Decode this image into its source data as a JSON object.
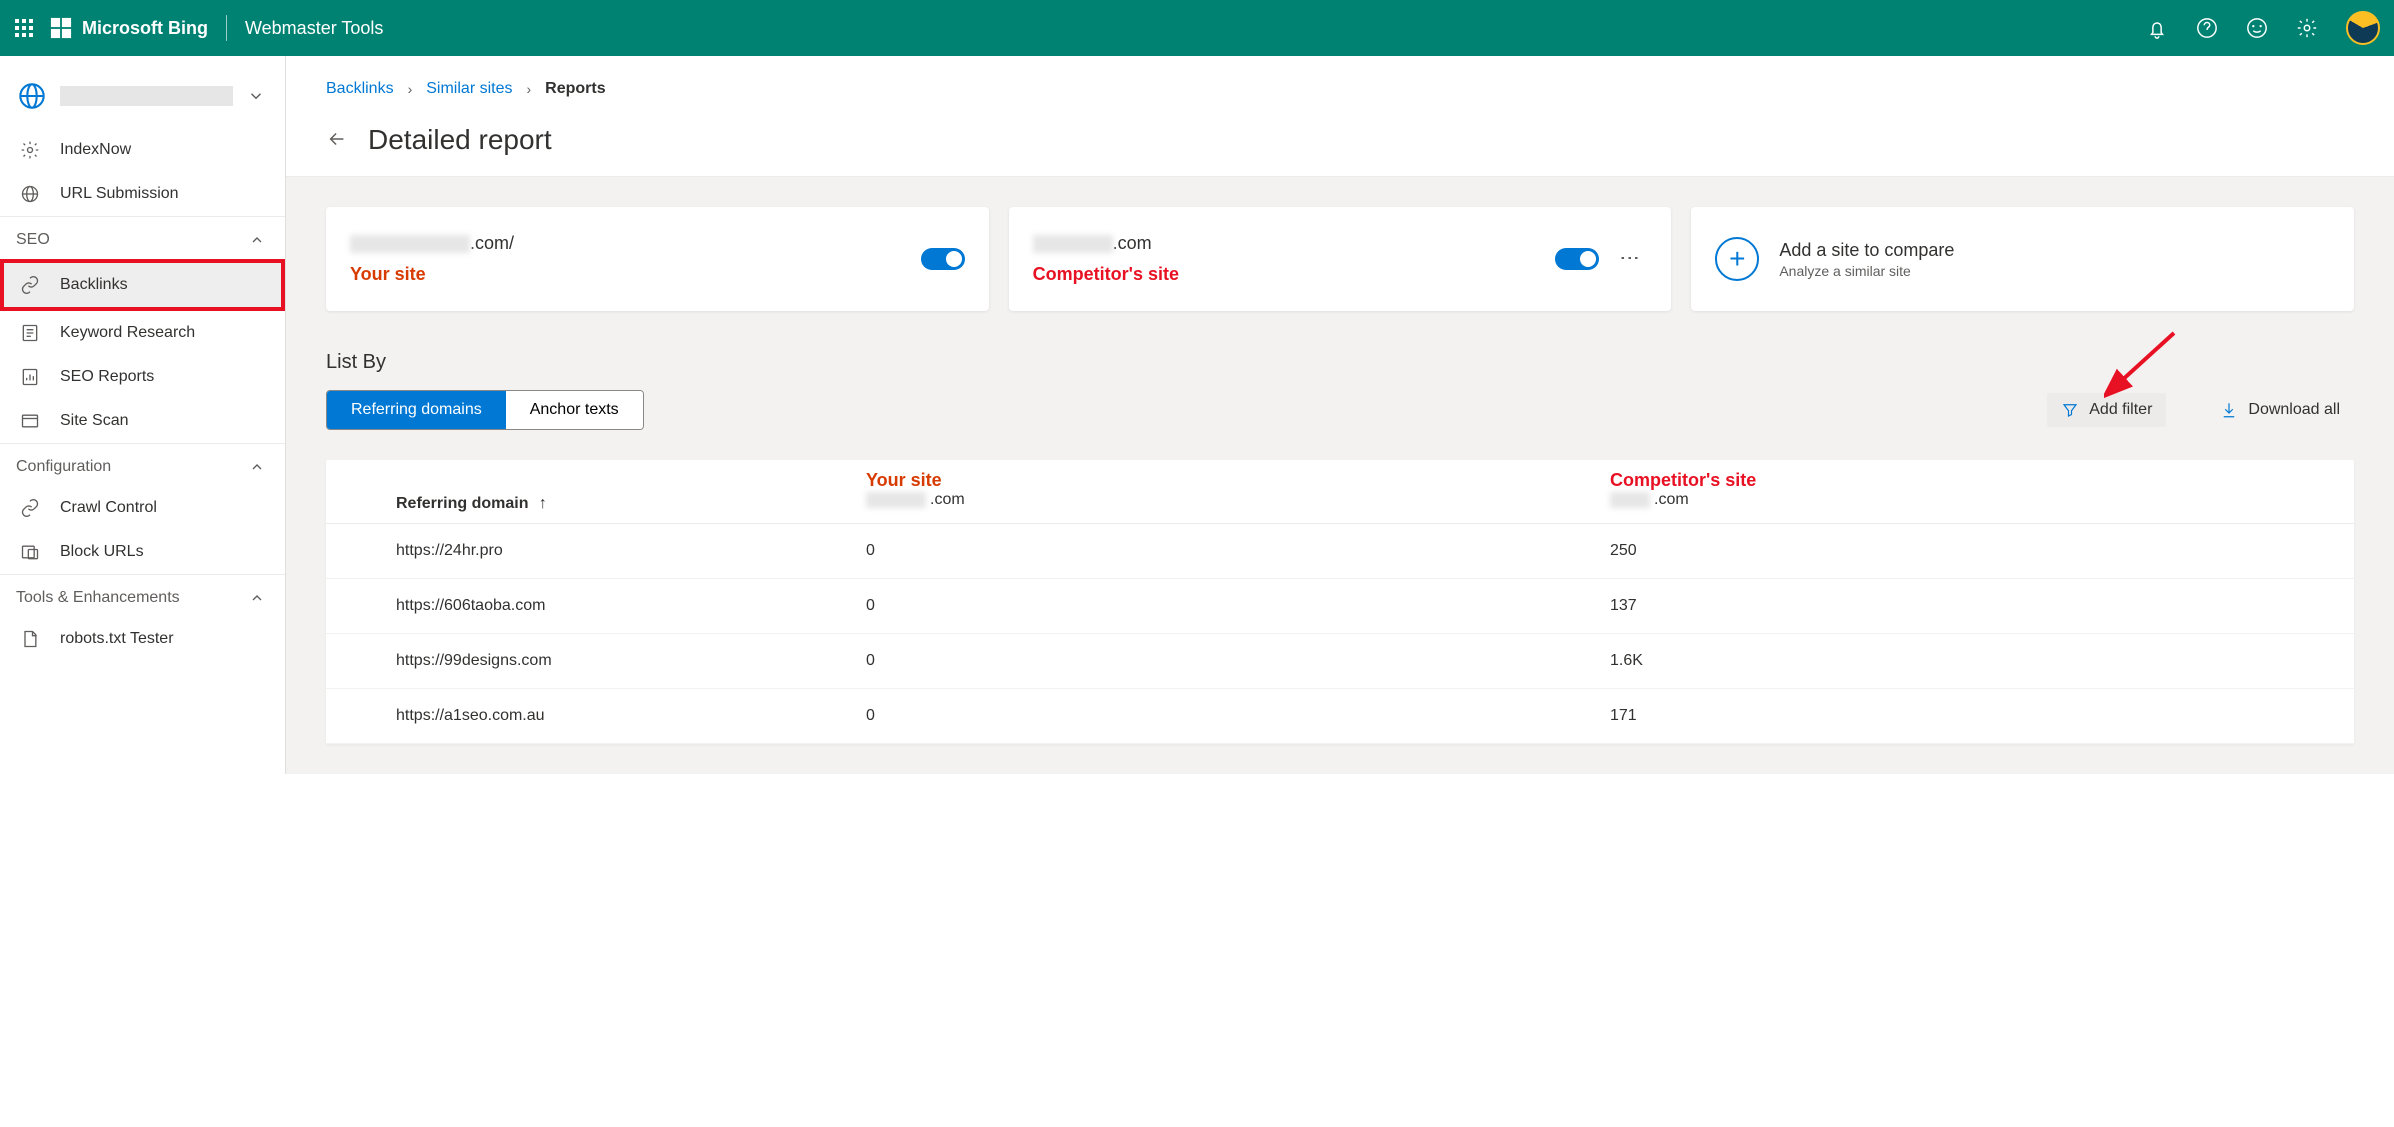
{
  "header": {
    "brand": "Microsoft Bing",
    "subbrand": "Webmaster Tools"
  },
  "sidebar": {
    "index_now": "IndexNow",
    "url_submission": "URL Submission",
    "groups": {
      "seo": "SEO",
      "config": "Configuration",
      "tools": "Tools & Enhancements"
    },
    "seo_items": {
      "backlinks": "Backlinks",
      "keyword": "Keyword Research",
      "reports": "SEO Reports",
      "sitescan": "Site Scan"
    },
    "config_items": {
      "crawl": "Crawl Control",
      "block": "Block URLs"
    },
    "tools_items": {
      "robots": "robots.txt Tester"
    }
  },
  "breadcrumb": {
    "backlinks": "Backlinks",
    "similar": "Similar sites",
    "current": "Reports"
  },
  "page_title": "Detailed report",
  "cards": {
    "your_site_suffix": ".com/",
    "your_site_label": "Your site",
    "comp_suffix": ".com",
    "comp_label": "Competitor's site",
    "add_title": "Add a site to compare",
    "add_sub": "Analyze a similar site"
  },
  "listby": {
    "heading": "List By",
    "tab_ref": "Referring domains",
    "tab_anchor": "Anchor texts",
    "add_filter": "Add filter",
    "download": "Download all"
  },
  "table": {
    "header_domain": "Referring domain",
    "your_site_top": "Your site",
    "your_site_suffix": ".com",
    "comp_top": "Competitor's site",
    "comp_suffix": ".com",
    "rows": [
      {
        "d": "https://24hr.pro",
        "y": "0",
        "c": "250"
      },
      {
        "d": "https://606taoba.com",
        "y": "0",
        "c": "137"
      },
      {
        "d": "https://99designs.com",
        "y": "0",
        "c": "1.6K"
      },
      {
        "d": "https://a1seo.com.au",
        "y": "0",
        "c": "171"
      }
    ]
  }
}
